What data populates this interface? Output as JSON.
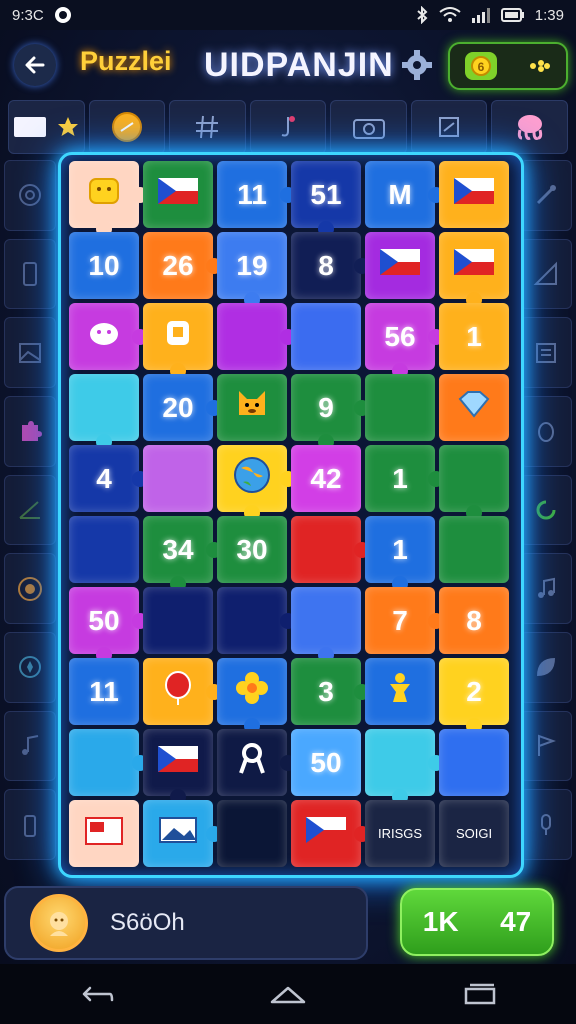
{
  "status_bar": {
    "left_text": "9:3C",
    "time": "1:39"
  },
  "header": {
    "title_left": "Puzzlei",
    "title_main": "UIDPANJIN"
  },
  "board": {
    "tiles": [
      {
        "label": "",
        "color": "#ffd6c2",
        "icon": "sun-icon"
      },
      {
        "label": "",
        "color": "#1e8e3e",
        "icon": "flag-icon"
      },
      {
        "label": "11",
        "color": "#1f6fe0"
      },
      {
        "label": "51",
        "color": "#1538a8"
      },
      {
        "label": "M",
        "color": "#1f6fe0"
      },
      {
        "label": "",
        "color": "#ffb11c",
        "icon": "flag-icon"
      },
      {
        "label": "10",
        "color": "#1f6fe0"
      },
      {
        "label": "26",
        "color": "#ff7a1a"
      },
      {
        "label": "19",
        "color": "#3d7cf0"
      },
      {
        "label": "8",
        "color": "#111e55"
      },
      {
        "label": "",
        "color": "#a42be0",
        "icon": "flag-icon"
      },
      {
        "label": "",
        "color": "#ffb11c",
        "icon": "flag-icon"
      },
      {
        "label": "",
        "color": "#c63be0",
        "icon": "animal-icon"
      },
      {
        "label": "",
        "color": "#ffb11c",
        "icon": "badge-icon"
      },
      {
        "label": "",
        "color": "#b02ee3"
      },
      {
        "label": "",
        "color": "#3b6cf0"
      },
      {
        "label": "56",
        "color": "#c63be0"
      },
      {
        "label": "1",
        "color": "#ffb11c"
      },
      {
        "label": "",
        "color": "#3ecbe8"
      },
      {
        "label": "20",
        "color": "#1f6fe0"
      },
      {
        "label": "",
        "color": "#1e8e3e",
        "icon": "dog-icon"
      },
      {
        "label": "9",
        "color": "#1e8e3e"
      },
      {
        "label": "",
        "color": "#1e8e3e"
      },
      {
        "label": "",
        "color": "#ff7a1a",
        "icon": "gem-icon"
      },
      {
        "label": "4",
        "color": "#1538a8"
      },
      {
        "label": "",
        "color": "#c063e8"
      },
      {
        "label": "",
        "color": "#ffd21f",
        "icon": "globe-icon"
      },
      {
        "label": "42",
        "color": "#d23ee6"
      },
      {
        "label": "1",
        "color": "#1e8e3e"
      },
      {
        "label": "",
        "color": "#1e8e3e"
      },
      {
        "label": "",
        "color": "#1538a8"
      },
      {
        "label": "34",
        "color": "#1e8e3e"
      },
      {
        "label": "30",
        "color": "#1e8e3e"
      },
      {
        "label": "",
        "color": "#e02424"
      },
      {
        "label": "1",
        "color": "#1f6fe0"
      },
      {
        "label": "",
        "color": "#1e8e3e"
      },
      {
        "label": "50",
        "color": "#c63be0"
      },
      {
        "label": "",
        "color": "#0f1f6e"
      },
      {
        "label": "",
        "color": "#0f1f6e"
      },
      {
        "label": "",
        "color": "#3e74f0"
      },
      {
        "label": "7",
        "color": "#ff7a1a"
      },
      {
        "label": "8",
        "color": "#ff7a1a"
      },
      {
        "label": "11",
        "color": "#1f6fe0"
      },
      {
        "label": "",
        "color": "#ffb11c",
        "icon": "balloon-icon"
      },
      {
        "label": "",
        "color": "#1f6fe0",
        "icon": "flower-icon"
      },
      {
        "label": "3",
        "color": "#1e8e3e"
      },
      {
        "label": "",
        "color": "#1f6fe0",
        "icon": "figure-icon"
      },
      {
        "label": "2",
        "color": "#ffd21f"
      },
      {
        "label": "",
        "color": "#2aa9ea"
      },
      {
        "label": "",
        "color": "#101a4a",
        "icon": "flag-icon"
      },
      {
        "label": "",
        "color": "#0f1a45",
        "icon": "ribbon-icon"
      },
      {
        "label": "50",
        "color": "#4aa8ff"
      },
      {
        "label": "",
        "color": "#3ecbe8"
      },
      {
        "label": "",
        "color": "#2f6ff0"
      },
      {
        "label": "",
        "color": "#ffd6c2",
        "icon": "stamp-icon"
      },
      {
        "label": "",
        "color": "#2aa9ea",
        "icon": "photo-icon"
      },
      {
        "label": "",
        "color": "#0b1636"
      },
      {
        "label": "",
        "color": "#e02424",
        "icon": "flag-icon"
      },
      {
        "label": "IRISGS",
        "color": "#1b2544"
      },
      {
        "label": "SOIGI",
        "color": "#1b2544"
      }
    ]
  },
  "player": {
    "name": "S6öOh"
  },
  "score": {
    "left": "1K",
    "right": "47"
  },
  "colors": {
    "frame": "#3ed7ff",
    "accent_gold": "#ffcf3a",
    "accent_green": "#4caf2f"
  }
}
